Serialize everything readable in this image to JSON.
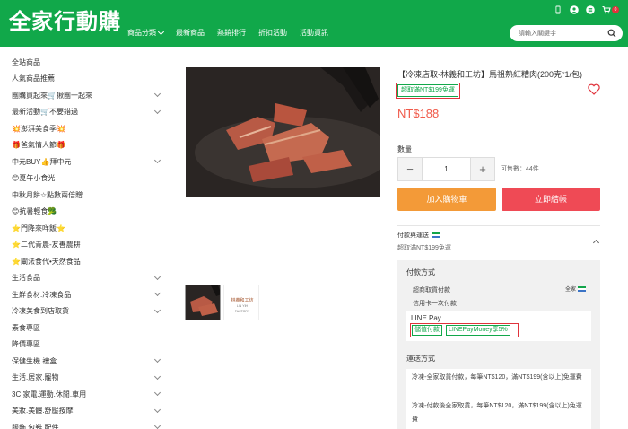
{
  "header": {
    "logo": "全家行動購",
    "nav": [
      "商品分類",
      "最新商品",
      "熱銷排行",
      "折扣活動",
      "活動資訊"
    ],
    "search_placeholder": "請輸入關鍵字",
    "cart_count": "0",
    "bg_color": "#11a84a"
  },
  "sidebar": {
    "items": [
      {
        "label": "全站商品",
        "expand": false
      },
      {
        "label": "人氣商品推薦",
        "expand": false
      },
      {
        "label": "團購買起來🛒揪團一起來",
        "expand": true
      },
      {
        "label": "最新活動🛒不要錯過",
        "expand": true
      },
      {
        "label": "💥澎湃美食季💥",
        "expand": false
      },
      {
        "label": "🎁爸氣情人節🎁",
        "expand": false
      },
      {
        "label": "中元BUY👍拜中元",
        "expand": true
      },
      {
        "label": "😊夏午小食光",
        "expand": false
      },
      {
        "label": "中秋月餅☆點數兩倍贈",
        "expand": false
      },
      {
        "label": "😊抗暑輕食🥦",
        "expand": false
      },
      {
        "label": "⭐門降來咩飯⭐",
        "expand": false
      },
      {
        "label": "⭐二代青農-友善農耕",
        "expand": false
      },
      {
        "label": "⭐闡法食代•天然食品",
        "expand": false
      },
      {
        "label": "生活食品",
        "expand": true
      },
      {
        "label": "生鮮食材.冷凍食品",
        "expand": true
      },
      {
        "label": "冷凍美食到店取貨",
        "expand": true
      },
      {
        "label": "素食專區",
        "expand": false
      },
      {
        "label": "降價專區",
        "expand": false
      },
      {
        "label": "保健生機.禮盒",
        "expand": true
      },
      {
        "label": "生活.居家.寵物",
        "expand": true
      },
      {
        "label": "3C.家電.運動.休閒.車用",
        "expand": true
      },
      {
        "label": "美妝.美體.舒壓按摩",
        "expand": true
      },
      {
        "label": "服飾.包鞋.配件",
        "expand": true
      }
    ]
  },
  "product": {
    "title": "【冷凍店取-林義和工坊】馬祖熟紅糟肉(200克*1/包)",
    "shipping_tag": "超取滿NT$199免運",
    "price": "NT$188",
    "quantity_label": "數量",
    "quantity_value": "1",
    "stock": "可售數：44件",
    "add_to_cart": "加入購物車",
    "buy_now": "立即結帳",
    "brand_logo_text": "林義和工坊",
    "brand_logo_sub": "LIN YIH FACTORY"
  },
  "payment": {
    "section_title": "付款與運送",
    "section_sub": "超取滿NT$199免運",
    "method_title": "付款方式",
    "methods": [
      "超商取貨付款",
      "信用卡一次付款"
    ],
    "familymart_label": "全家",
    "linepay_title": "LINE Pay",
    "linepay_tags": [
      "儲值付款",
      "LINEPayMoney享5%"
    ],
    "shipping_title": "運送方式",
    "shipping_lines": [
      "冷凍-全家取貨付款，每筆NT$120，滿NT$199(含以上)免運費",
      "冷凍-付款後全家取貨，每筆NT$120，滿NT$199(含以上)免運費"
    ]
  }
}
